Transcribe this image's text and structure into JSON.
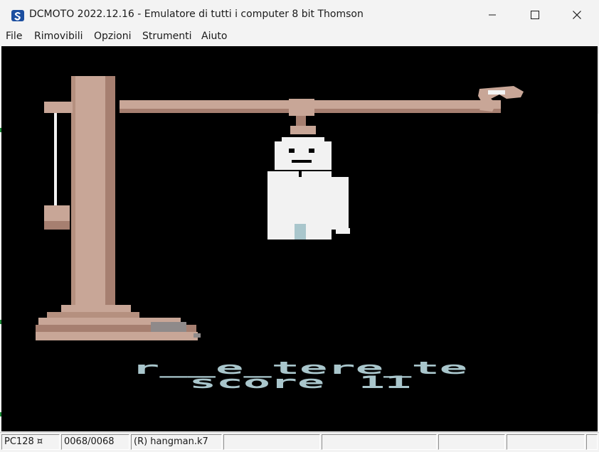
{
  "window": {
    "title": "DCMOTO 2022.12.16 - Emulatore di tutti i computer 8 bit Thomson"
  },
  "menu": {
    "items": [
      "File",
      "Rimovibili",
      "Opzioni",
      "Strumenti",
      "Aiuto"
    ]
  },
  "game": {
    "word": "r__e_tere_te",
    "score_label": "score",
    "score_value": "11"
  },
  "status": {
    "machine": "PC128 ¤",
    "counter": "0068/0068",
    "file": "(R) hangman.k7"
  },
  "colors": {
    "gallows": "#c8a697",
    "gallows_shadow": "#a67f70",
    "text": "#a9c6cc",
    "man": "#f2f2f2"
  }
}
